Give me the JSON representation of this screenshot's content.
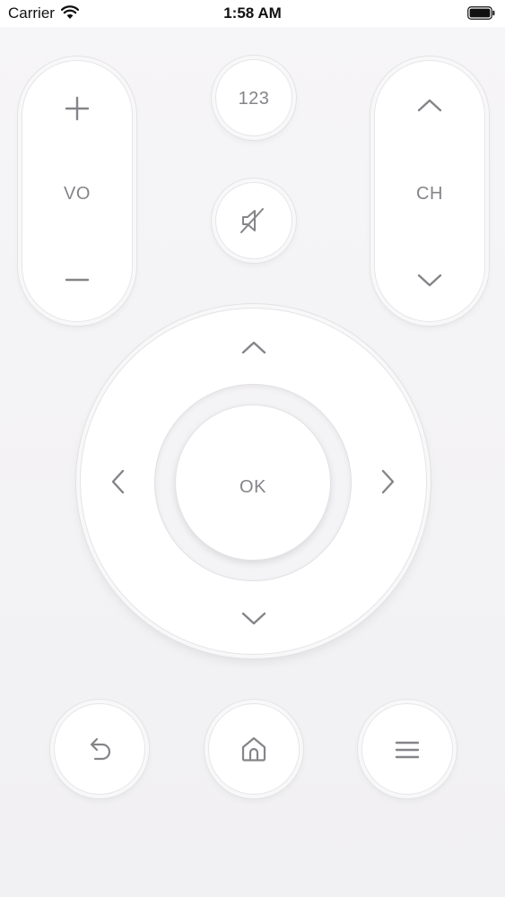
{
  "status_bar": {
    "carrier": "Carrier",
    "time": "1:58 AM"
  },
  "remote": {
    "volume": {
      "label": "VO",
      "plus_icon": "plus-icon",
      "minus_icon": "minus-icon"
    },
    "numbers": {
      "label": "123"
    },
    "mute": {
      "icon": "mute-speaker-icon"
    },
    "channel": {
      "label": "CH",
      "up_icon": "chevron-up-icon",
      "down_icon": "chevron-down-icon"
    },
    "dpad": {
      "ok_label": "OK",
      "up_icon": "chevron-up-icon",
      "down_icon": "chevron-down-icon",
      "left_icon": "chevron-left-icon",
      "right_icon": "chevron-right-icon"
    },
    "bottom": {
      "back_icon": "back-arrow-icon",
      "home_icon": "home-icon",
      "menu_icon": "menu-icon"
    }
  },
  "colors": {
    "background": "#f3f2f4",
    "button": "#ffffff",
    "icon": "#858489"
  }
}
